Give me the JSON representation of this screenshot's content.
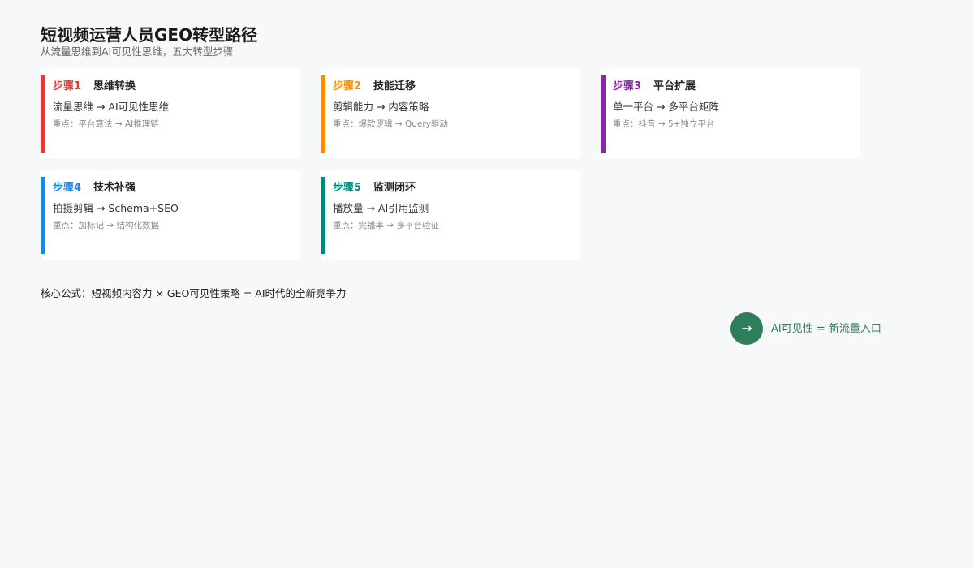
{
  "header": {
    "title": "短视频运营人员GEO转型路径",
    "subtitle": "从流量思维到AI可见性思维，五大转型步骤"
  },
  "steps": [
    {
      "label": "步骤1",
      "title": "思维转换",
      "transform": "流量思维 → AI可见性思维",
      "focus": "重点：平台算法 → AI推理链",
      "color": "#e53935"
    },
    {
      "label": "步骤2",
      "title": "技能迁移",
      "transform": "剪辑能力 → 内容策略",
      "focus": "重点：爆款逻辑 → Query驱动",
      "color": "#fb8c00"
    },
    {
      "label": "步骤3",
      "title": "平台扩展",
      "transform": "单一平台 → 多平台矩阵",
      "focus": "重点：抖音 → 5+独立平台",
      "color": "#8e24aa"
    },
    {
      "label": "步骤4",
      "title": "技术补强",
      "transform": "拍摄剪辑 → Schema+SEO",
      "focus": "重点：加标记 → 结构化数据",
      "color": "#1e88e5"
    },
    {
      "label": "步骤5",
      "title": "监测闭环",
      "transform": "播放量 → AI引用监测",
      "focus": "重点：完播率 → 多平台验证",
      "color": "#00897b"
    }
  ],
  "formula": "核心公式：短视频内容力 × GEO可见性策略 = AI时代的全新竞争力",
  "cta": {
    "arrow": "→",
    "text": "AI可见性 = 新流量入口",
    "color": "#2e7d5b"
  }
}
